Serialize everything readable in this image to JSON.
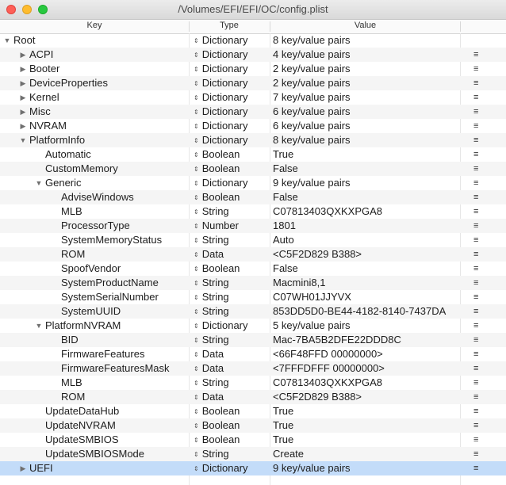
{
  "window": {
    "title": "/Volumes/EFI/EFI/OC/config.plist"
  },
  "columns": {
    "key": "Key",
    "type": "Type",
    "value": "Value"
  },
  "icons": {
    "expanded": "▼",
    "collapsed": "▶",
    "type_stepper": "⇕",
    "row_menu": "≡"
  },
  "rows": [
    {
      "key": "Root",
      "type": "Dictionary",
      "value": "8 key/value pairs",
      "level": 0,
      "disclosure": "expanded",
      "menu": false,
      "selected": false
    },
    {
      "key": "ACPI",
      "type": "Dictionary",
      "value": "4 key/value pairs",
      "level": 1,
      "disclosure": "collapsed",
      "menu": true,
      "selected": false
    },
    {
      "key": "Booter",
      "type": "Dictionary",
      "value": "2 key/value pairs",
      "level": 1,
      "disclosure": "collapsed",
      "menu": true,
      "selected": false
    },
    {
      "key": "DeviceProperties",
      "type": "Dictionary",
      "value": "2 key/value pairs",
      "level": 1,
      "disclosure": "collapsed",
      "menu": true,
      "selected": false
    },
    {
      "key": "Kernel",
      "type": "Dictionary",
      "value": "7 key/value pairs",
      "level": 1,
      "disclosure": "collapsed",
      "menu": true,
      "selected": false
    },
    {
      "key": "Misc",
      "type": "Dictionary",
      "value": "6 key/value pairs",
      "level": 1,
      "disclosure": "collapsed",
      "menu": true,
      "selected": false
    },
    {
      "key": "NVRAM",
      "type": "Dictionary",
      "value": "6 key/value pairs",
      "level": 1,
      "disclosure": "collapsed",
      "menu": true,
      "selected": false
    },
    {
      "key": "PlatformInfo",
      "type": "Dictionary",
      "value": "8 key/value pairs",
      "level": 1,
      "disclosure": "expanded",
      "menu": true,
      "selected": false
    },
    {
      "key": "Automatic",
      "type": "Boolean",
      "value": "True",
      "level": 2,
      "disclosure": "",
      "menu": true,
      "selected": false
    },
    {
      "key": "CustomMemory",
      "type": "Boolean",
      "value": "False",
      "level": 2,
      "disclosure": "",
      "menu": true,
      "selected": false
    },
    {
      "key": "Generic",
      "type": "Dictionary",
      "value": "9 key/value pairs",
      "level": 2,
      "disclosure": "expanded",
      "menu": true,
      "selected": false
    },
    {
      "key": "AdviseWindows",
      "type": "Boolean",
      "value": "False",
      "level": 3,
      "disclosure": "",
      "menu": true,
      "selected": false
    },
    {
      "key": "MLB",
      "type": "String",
      "value": "C07813403QXKXPGA8",
      "level": 3,
      "disclosure": "",
      "menu": true,
      "selected": false
    },
    {
      "key": "ProcessorType",
      "type": "Number",
      "value": "1801",
      "level": 3,
      "disclosure": "",
      "menu": true,
      "selected": false
    },
    {
      "key": "SystemMemoryStatus",
      "type": "String",
      "value": "Auto",
      "level": 3,
      "disclosure": "",
      "menu": true,
      "selected": false
    },
    {
      "key": "ROM",
      "type": "Data",
      "value": "<C5F2D829 B388>",
      "level": 3,
      "disclosure": "",
      "menu": true,
      "selected": false
    },
    {
      "key": "SpoofVendor",
      "type": "Boolean",
      "value": "False",
      "level": 3,
      "disclosure": "",
      "menu": true,
      "selected": false
    },
    {
      "key": "SystemProductName",
      "type": "String",
      "value": "Macmini8,1",
      "level": 3,
      "disclosure": "",
      "menu": true,
      "selected": false
    },
    {
      "key": "SystemSerialNumber",
      "type": "String",
      "value": "C07WH01JJYVX",
      "level": 3,
      "disclosure": "",
      "menu": true,
      "selected": false
    },
    {
      "key": "SystemUUID",
      "type": "String",
      "value": "853DD5D0-BE44-4182-8140-7437DA",
      "level": 3,
      "disclosure": "",
      "menu": true,
      "selected": false
    },
    {
      "key": "PlatformNVRAM",
      "type": "Dictionary",
      "value": "5 key/value pairs",
      "level": 2,
      "disclosure": "expanded",
      "menu": true,
      "selected": false
    },
    {
      "key": "BID",
      "type": "String",
      "value": "Mac-7BA5B2DFE22DDD8C",
      "level": 3,
      "disclosure": "",
      "menu": true,
      "selected": false
    },
    {
      "key": "FirmwareFeatures",
      "type": "Data",
      "value": "<66F48FFD 00000000>",
      "level": 3,
      "disclosure": "",
      "menu": true,
      "selected": false
    },
    {
      "key": "FirmwareFeaturesMask",
      "type": "Data",
      "value": "<7FFFDFFF 00000000>",
      "level": 3,
      "disclosure": "",
      "menu": true,
      "selected": false
    },
    {
      "key": "MLB",
      "type": "String",
      "value": "C07813403QXKXPGA8",
      "level": 3,
      "disclosure": "",
      "menu": true,
      "selected": false
    },
    {
      "key": "ROM",
      "type": "Data",
      "value": "<C5F2D829 B388>",
      "level": 3,
      "disclosure": "",
      "menu": true,
      "selected": false
    },
    {
      "key": "UpdateDataHub",
      "type": "Boolean",
      "value": "True",
      "level": 2,
      "disclosure": "",
      "menu": true,
      "selected": false
    },
    {
      "key": "UpdateNVRAM",
      "type": "Boolean",
      "value": "True",
      "level": 2,
      "disclosure": "",
      "menu": true,
      "selected": false
    },
    {
      "key": "UpdateSMBIOS",
      "type": "Boolean",
      "value": "True",
      "level": 2,
      "disclosure": "",
      "menu": true,
      "selected": false
    },
    {
      "key": "UpdateSMBIOSMode",
      "type": "String",
      "value": "Create",
      "level": 2,
      "disclosure": "",
      "menu": true,
      "selected": false
    },
    {
      "key": "UEFI",
      "type": "Dictionary",
      "value": "9 key/value pairs",
      "level": 1,
      "disclosure": "collapsed",
      "menu": true,
      "selected": true
    }
  ]
}
